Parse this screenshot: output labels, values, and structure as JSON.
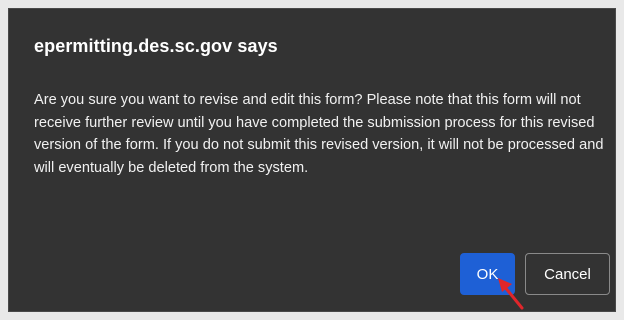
{
  "dialog": {
    "title": "epermitting.des.sc.gov says",
    "message": "Are you sure you want to revise and edit this form? Please note that this form will not receive further review until you have completed the submission process for this revised version of the form. If you do not submit this revised version, it will not be processed and will eventually be deleted from the system.",
    "ok_label": "OK",
    "cancel_label": "Cancel"
  },
  "colors": {
    "dialog_background": "#333333",
    "primary_button": "#1e60d6",
    "annotation_arrow": "#e0262b"
  },
  "annotation": {
    "icon": "red-arrow-icon"
  }
}
